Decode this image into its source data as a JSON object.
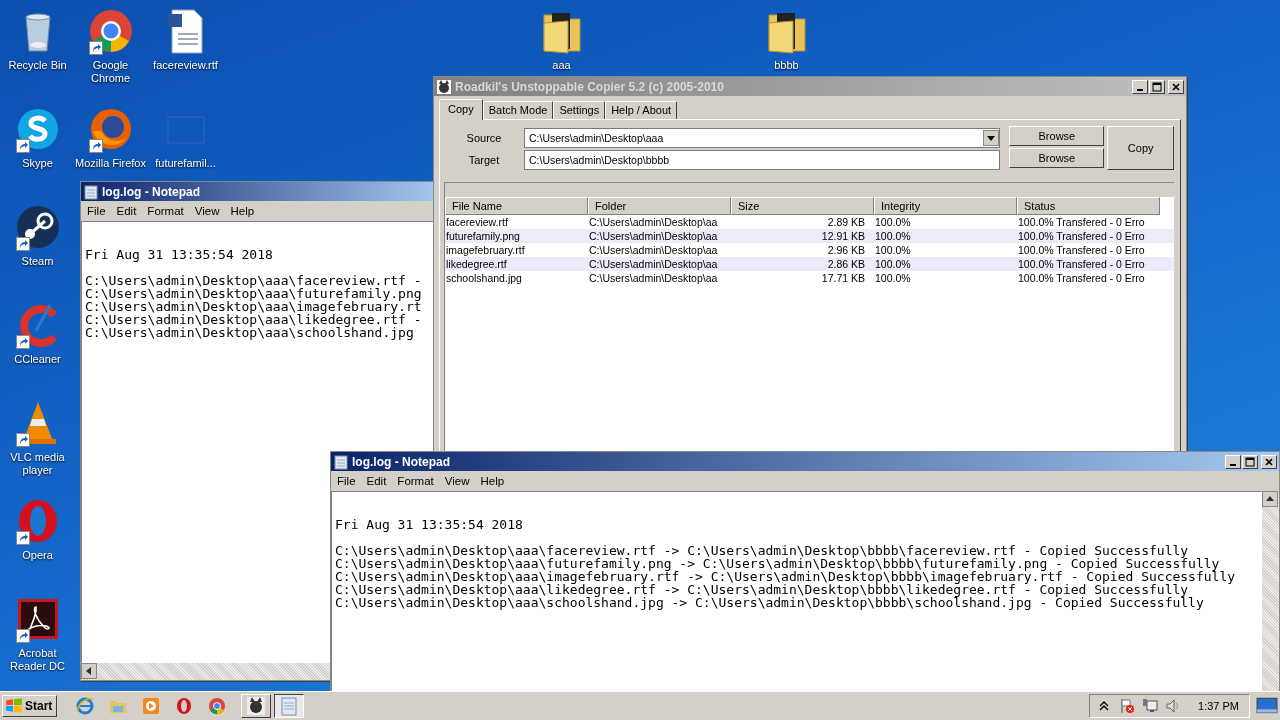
{
  "desktop": {
    "icons": [
      {
        "label": "Recycle Bin",
        "kind": "recycle",
        "shortcut": false
      },
      {
        "label": "Google Chrome",
        "kind": "chrome",
        "shortcut": true
      },
      {
        "label": "facereview.rtf",
        "kind": "document",
        "shortcut": false
      },
      {
        "label": "aaa",
        "kind": "folder",
        "shortcut": false
      },
      {
        "label": "bbbb",
        "kind": "folder",
        "shortcut": false
      },
      {
        "label": "Skype",
        "kind": "skype",
        "shortcut": true
      },
      {
        "label": "Mozilla Firefox",
        "kind": "firefox",
        "shortcut": true
      },
      {
        "label": "futurefamil...",
        "kind": "blank",
        "shortcut": false
      },
      {
        "label": "Steam",
        "kind": "steam",
        "shortcut": true
      },
      {
        "label": "CCleaner",
        "kind": "ccleaner",
        "shortcut": true
      },
      {
        "label": "VLC media player",
        "kind": "vlc",
        "shortcut": true
      },
      {
        "label": "Opera",
        "kind": "opera",
        "shortcut": true
      },
      {
        "label": "Acrobat Reader DC",
        "kind": "acrobat",
        "shortcut": true
      }
    ]
  },
  "notepad_back": {
    "title": "log.log - Notepad",
    "menu": [
      "File",
      "Edit",
      "Format",
      "View",
      "Help"
    ],
    "date_line": "Fri Aug 31 13:35:54 2018",
    "lines": [
      "C:\\Users\\admin\\Desktop\\aaa\\facereview.rtf -",
      "C:\\Users\\admin\\Desktop\\aaa\\futurefamily.png",
      "C:\\Users\\admin\\Desktop\\aaa\\imagefebruary.rt",
      "C:\\Users\\admin\\Desktop\\aaa\\likedegree.rtf -",
      "C:\\Users\\admin\\Desktop\\aaa\\schoolshand.jpg"
    ]
  },
  "copier": {
    "title": "Roadkil's Unstoppable Copier 5.2 (c) 2005-2010",
    "tabs": [
      {
        "label": "Copy",
        "selected": true
      },
      {
        "label": "Batch Mode",
        "selected": false
      },
      {
        "label": "Settings",
        "selected": false
      },
      {
        "label": "Help / About",
        "selected": false
      }
    ],
    "source_label": "Source",
    "source": "C:\\Users\\admin\\Desktop\\aaa",
    "target_label": "Target",
    "target": "C:\\Users\\admin\\Desktop\\bbbb",
    "browse_buttons": [
      "Browse",
      "Browse"
    ],
    "copy_button": "Copy",
    "table": {
      "columns": [
        "File Name",
        "Folder",
        "Size",
        "Integrity",
        "Status"
      ],
      "rows": [
        [
          "facereview.rtf",
          "C:\\Users\\admin\\Desktop\\aa",
          "2.89 KB",
          "100.0%",
          "100.0% Transfered - 0 Erro"
        ],
        [
          "futurefamily.png",
          "C:\\Users\\admin\\Desktop\\aa",
          "12.91 KB",
          "100.0%",
          "100.0% Transfered - 0 Erro"
        ],
        [
          "imagefebruary.rtf",
          "C:\\Users\\admin\\Desktop\\aa",
          "2.96 KB",
          "100.0%",
          "100.0% Transfered - 0 Erro"
        ],
        [
          "likedegree.rtf",
          "C:\\Users\\admin\\Desktop\\aa",
          "2.86 KB",
          "100.0%",
          "100.0% Transfered - 0 Erro"
        ],
        [
          "schoolshand.jpg",
          "C:\\Users\\admin\\Desktop\\aa",
          "17.71 KB",
          "100.0%",
          "100.0% Transfered - 0 Erro"
        ]
      ]
    }
  },
  "notepad_front": {
    "title": "log.log - Notepad",
    "menu": [
      "File",
      "Edit",
      "Format",
      "View",
      "Help"
    ],
    "date_line": "Fri Aug 31 13:35:54 2018",
    "lines": [
      "C:\\Users\\admin\\Desktop\\aaa\\facereview.rtf -> C:\\Users\\admin\\Desktop\\bbbb\\facereview.rtf - Copied Successfully",
      "C:\\Users\\admin\\Desktop\\aaa\\futurefamily.png -> C:\\Users\\admin\\Desktop\\bbbb\\futurefamily.png - Copied Successfully",
      "C:\\Users\\admin\\Desktop\\aaa\\imagefebruary.rtf -> C:\\Users\\admin\\Desktop\\bbbb\\imagefebruary.rtf - Copied Successfully",
      "C:\\Users\\admin\\Desktop\\aaa\\likedegree.rtf -> C:\\Users\\admin\\Desktop\\bbbb\\likedegree.rtf - Copied Successfully",
      "C:\\Users\\admin\\Desktop\\aaa\\schoolshand.jpg -> C:\\Users\\admin\\Desktop\\bbbb\\schoolshand.jpg - Copied Successfully"
    ]
  },
  "taskbar": {
    "start": "Start",
    "quick_launch": [
      {
        "kind": "ie"
      },
      {
        "kind": "explorer"
      },
      {
        "kind": "media"
      },
      {
        "kind": "opera"
      },
      {
        "kind": "chrome"
      }
    ],
    "tasks": [
      {
        "kind": "copier",
        "selected": false
      },
      {
        "kind": "notepad",
        "selected": true
      }
    ],
    "clock": "1:37 PM"
  }
}
